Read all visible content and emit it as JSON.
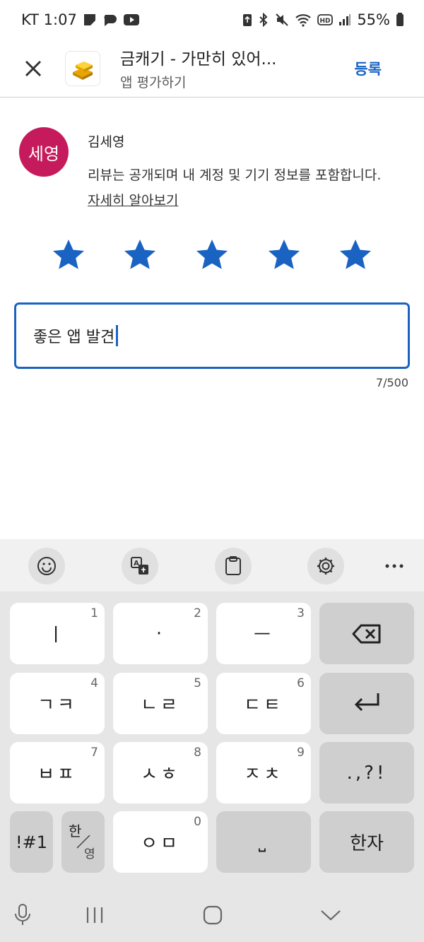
{
  "status_bar": {
    "carrier_time": "KT 1:07",
    "battery": "55%"
  },
  "header": {
    "app_title": "금캐기 - 가만히 있어...",
    "subtitle": "앱 평가하기",
    "submit_label": "등록"
  },
  "user": {
    "avatar_text": "세영",
    "name": "김세영",
    "notice": "리뷰는 공개되며 내 계정 및 기기 정보를 포함합니다.",
    "learn_more": "자세히 알아보기"
  },
  "rating": {
    "value": 5,
    "max": 5
  },
  "review": {
    "text": "좋은 앱 발견",
    "counter": "7/500"
  },
  "keyboard": {
    "keys": [
      {
        "glyph": "ㅣ",
        "num": "1"
      },
      {
        "glyph": "·",
        "num": "2"
      },
      {
        "glyph": "ㅡ",
        "num": "3"
      },
      {
        "glyph": "ㄱㅋ",
        "num": "4"
      },
      {
        "glyph": "ㄴㄹ",
        "num": "5"
      },
      {
        "glyph": "ㄷㅌ",
        "num": "6"
      },
      {
        "glyph": "ㅂㅍ",
        "num": "7"
      },
      {
        "glyph": "ㅅㅎ",
        "num": "8"
      },
      {
        "glyph": "ㅈㅊ",
        "num": "9"
      },
      {
        "glyph": "ㅇㅁ",
        "num": "0"
      }
    ],
    "punct": ".,?!",
    "symbols": "!#1",
    "lang_top": "한",
    "lang_bottom": "영",
    "space": "⎵",
    "hanja": "한자"
  },
  "colors": {
    "accent": "#1a63c2",
    "avatar": "#c51b5c",
    "star": "#1a63c2"
  }
}
